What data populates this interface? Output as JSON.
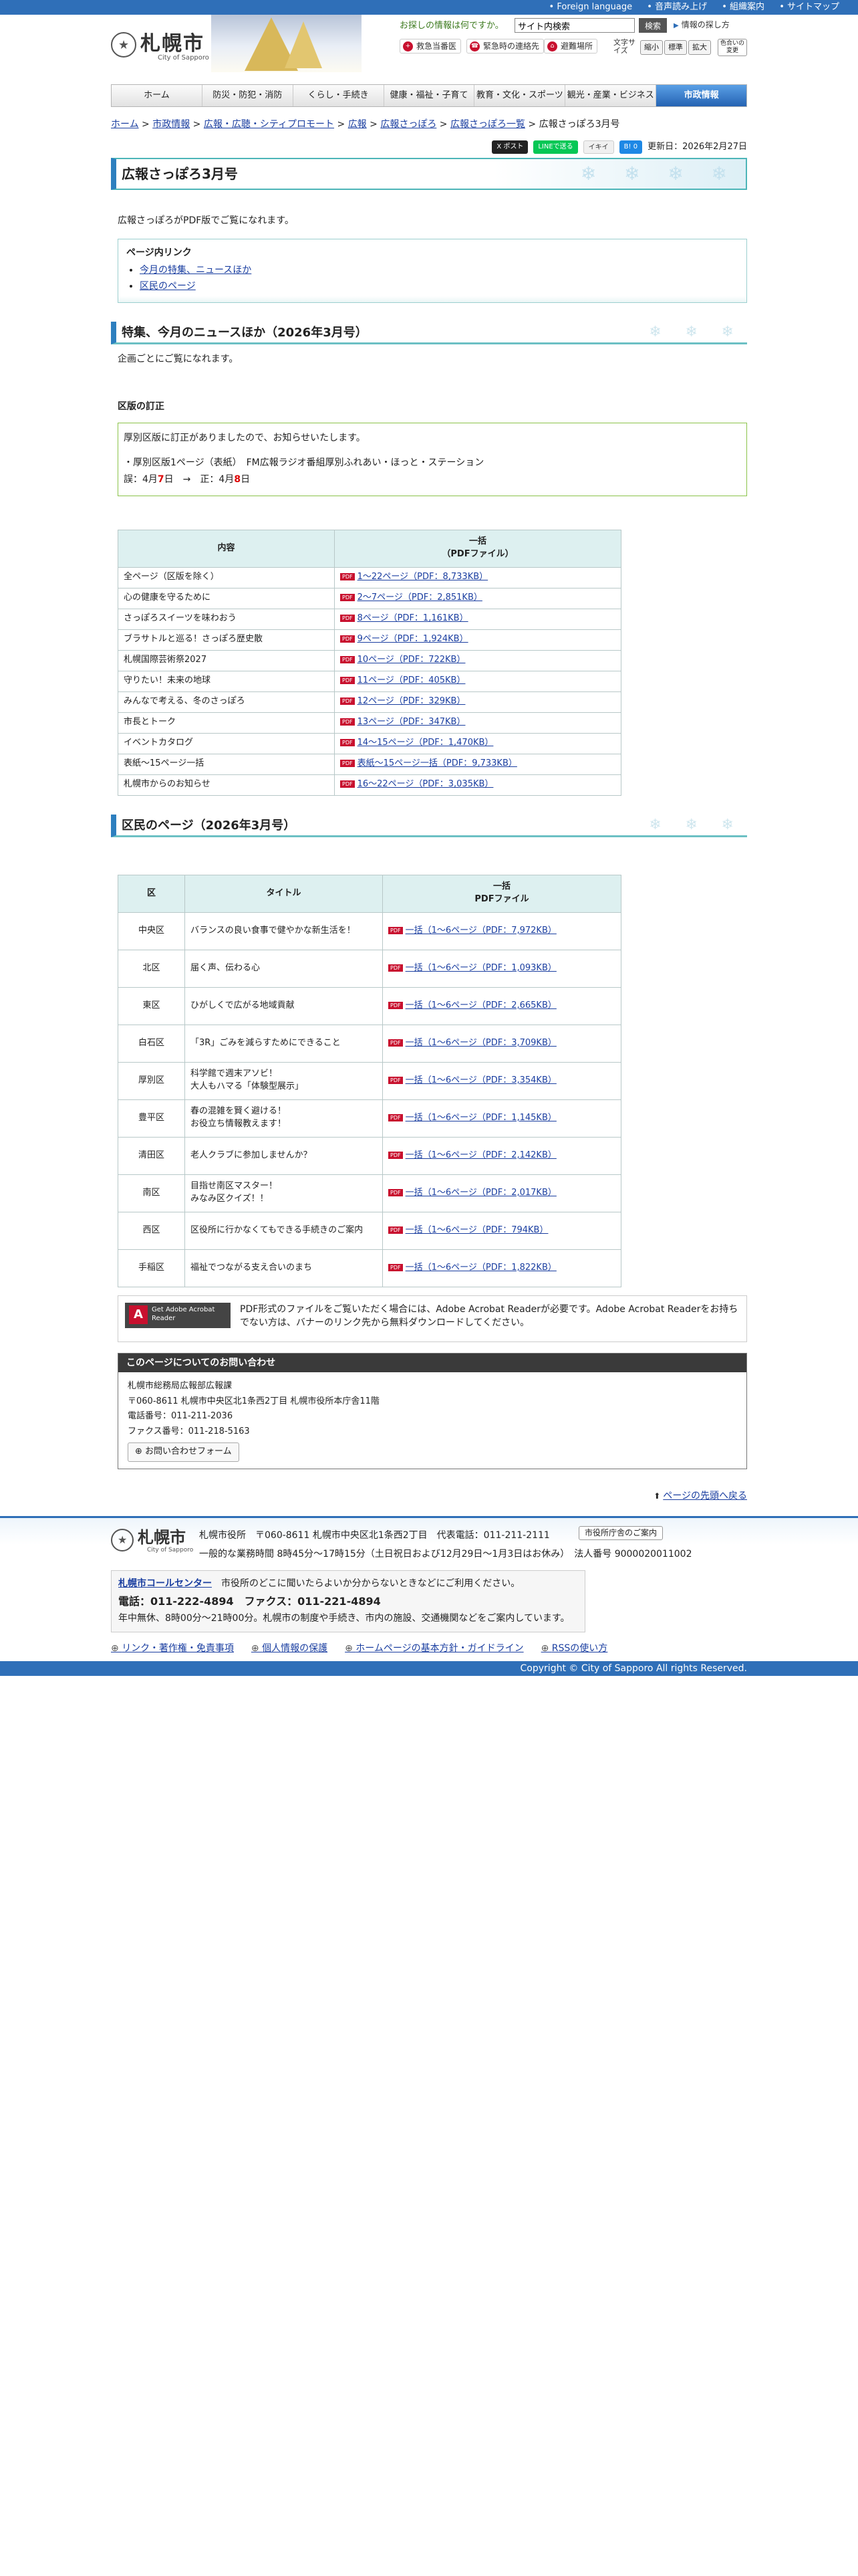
{
  "topbar": {
    "items": [
      "• Foreign language",
      "• 音声読み上げ",
      "• 組織案内",
      "• サイトマップ"
    ]
  },
  "header": {
    "logo_jp": "札幌市",
    "logo_en": "City of Sapporo",
    "search_label": "お探しの情報は何ですか。",
    "search_value": "サイト内検索",
    "search_button": "検索",
    "how_to_search": "情報の探し方",
    "buttons": [
      "救急当番医",
      "緊急時の連絡先",
      "避難場所"
    ],
    "fontsize_label": "文字サイズ",
    "fontsize": [
      "縮小",
      "標準",
      "拡大"
    ],
    "color_change": "色合いの変更"
  },
  "nav": [
    "ホーム",
    "防災・防犯・消防",
    "くらし・手続き",
    "健康・福祉・子育て",
    "教育・文化・スポーツ",
    "観光・産業・ビジネス",
    "市政情報"
  ],
  "breadcrumb": {
    "items": [
      "ホーム",
      "市政情報",
      "広報・広聴・シティプロモート",
      "広報",
      "広報さっぽろ",
      "広報さっぽろ一覧"
    ],
    "current": "広報さっぽろ3月号",
    "sep": " > "
  },
  "share": {
    "x": "X ポスト",
    "line": "LINEで送る",
    "ikiiki": "イキイ",
    "bm": "B! 0",
    "updated": "更新日：2026年2月27日"
  },
  "page": {
    "title": "広報さっぽろ3月号",
    "lead": "広報さっぽろがPDF版でご覧になれます。"
  },
  "toc": {
    "title": "ページ内リンク",
    "items": [
      "今月の特集、ニュースほか",
      "区民のページ"
    ]
  },
  "section1": {
    "title": "特集、今月のニュースほか（2026年3月号）",
    "desc": "企画ごとにご覧になれます。",
    "correction_title": "区版の訂正",
    "correction_l1": "厚別区版に訂正がありましたので、お知らせいたします。",
    "correction_l2": "・厚別区版1ページ（表紙）　FM広報ラジオ番組厚別ふれあい・ほっと・ステーション",
    "correction_l3a": "誤：4月",
    "correction_l3b": "7",
    "correction_l3c": "日　→　正：4月",
    "correction_l3d": "8",
    "correction_l3e": "日"
  },
  "table1": {
    "h1": "内容",
    "h2a": "一括",
    "h2b": "（PDFファイル）",
    "rows": [
      [
        "全ページ（区版を除く）",
        "1〜22ページ（PDF：8,733KB）"
      ],
      [
        "心の健康を守るために",
        "2〜7ページ（PDF：2,851KB）"
      ],
      [
        "さっぽろスイーツを味わおう",
        "8ページ（PDF：1,161KB）"
      ],
      [
        "ブラサトルと巡る！さっぽろ歴史散",
        "9ページ（PDF：1,924KB）"
      ],
      [
        "札幌国際芸術祭2027",
        "10ページ（PDF：722KB）"
      ],
      [
        "守りたい！未来の地球",
        "11ページ（PDF：405KB）"
      ],
      [
        "みんなで考える、冬のさっぽろ",
        "12ページ（PDF：329KB）"
      ],
      [
        "市長とトーク",
        "13ページ（PDF：347KB）"
      ],
      [
        "イベントカタログ",
        "14〜15ページ（PDF：1,470KB）"
      ],
      [
        "表紙〜15ページ一括",
        "表紙〜15ページ一括（PDF：9,733KB）"
      ],
      [
        "札幌市からのお知らせ",
        "16〜22ページ（PDF：3,035KB）"
      ]
    ]
  },
  "section2": {
    "title": "区民のページ（2026年3月号）"
  },
  "table2": {
    "h1": "区",
    "h2": "タイトル",
    "h3a": "一括",
    "h3b": "PDFファイル",
    "rows": [
      [
        "中央区",
        "バランスの良い食事で健やかな新生活を！",
        "一括（1〜6ページ（PDF：7,972KB）"
      ],
      [
        "北区",
        "届く声、伝わる心",
        "一括（1〜6ページ（PDF：1,093KB）"
      ],
      [
        "東区",
        "ひがしくで広がる地域貢献",
        "一括（1〜6ページ（PDF：2,665KB）"
      ],
      [
        "白石区",
        "「3R」ごみを減らすためにできること",
        "一括（1〜6ページ（PDF：3,709KB）"
      ],
      [
        "厚別区",
        "科学館で週末アソビ！\n大人もハマる「体験型展示」",
        "一括（1〜6ページ（PDF：3,354KB）"
      ],
      [
        "豊平区",
        "春の混雑を賢く避ける！\nお役立ち情報教えます！",
        "一括（1〜6ページ（PDF：1,145KB）"
      ],
      [
        "清田区",
        "老人クラブに参加しませんか？",
        "一括（1〜6ページ（PDF：2,142KB）"
      ],
      [
        "南区",
        "目指せ南区マスター！\nみなみ区クイズ！！",
        "一括（1〜6ページ（PDF：2,017KB）"
      ],
      [
        "西区",
        "区役所に行かなくてもできる手続きのご案内",
        "一括（1〜6ページ（PDF：794KB）"
      ],
      [
        "手稲区",
        "福祉でつながる支え合いのまち",
        "一括（1〜6ページ（PDF：1,822KB）"
      ]
    ]
  },
  "acrobat": {
    "banner": "Get Adobe Acrobat Reader",
    "text": "PDF形式のファイルをご覧いただく場合には、Adobe Acrobat Readerが必要です。Adobe Acrobat Readerをお持ちでない方は、バナーのリンク先から無料ダウンロードしてください。"
  },
  "contact": {
    "title": "このページについてのお問い合わせ",
    "org": "札幌市総務局広報部広報課",
    "addr": "〒060-8611 札幌市中央区北1条西2丁目 札幌市役所本庁舎11階",
    "tel": "電話番号：011-211-2036",
    "fax": "ファクス番号：011-218-5163",
    "form": "お問い合わせフォーム"
  },
  "back": "ページの先頭へ戻る",
  "footer": {
    "logo_jp": "札幌市",
    "logo_en": "City of Sapporo",
    "addr1": "札幌市役所　〒060-8611 札幌市中央区北1条西2丁目　代表電話：011-211-2111",
    "addr2": "一般的な業務時間 8時45分〜17時15分（土日祝日および12月29日〜1月3日はお休み）　法人番号 9000020011002",
    "guide_btn": "市役所庁舎のご案内",
    "call_name": "札幌市コールセンター",
    "call_desc": "市役所のどこに聞いたらよいか分からないときなどにご利用ください。",
    "call_tel": "電話：011-222-4894　ファクス：011-221-4894",
    "call_hours": "年中無休、8時00分〜21時00分。札幌市の制度や手続き、市内の施設、交通機関などをご案内しています。",
    "links": [
      "リンク・著作権・免責事項",
      "個人情報の保護",
      "ホームページの基本方針・ガイドライン",
      "RSSの使い方"
    ],
    "copyright": "Copyright © City of Sapporo All rights Reserved."
  }
}
